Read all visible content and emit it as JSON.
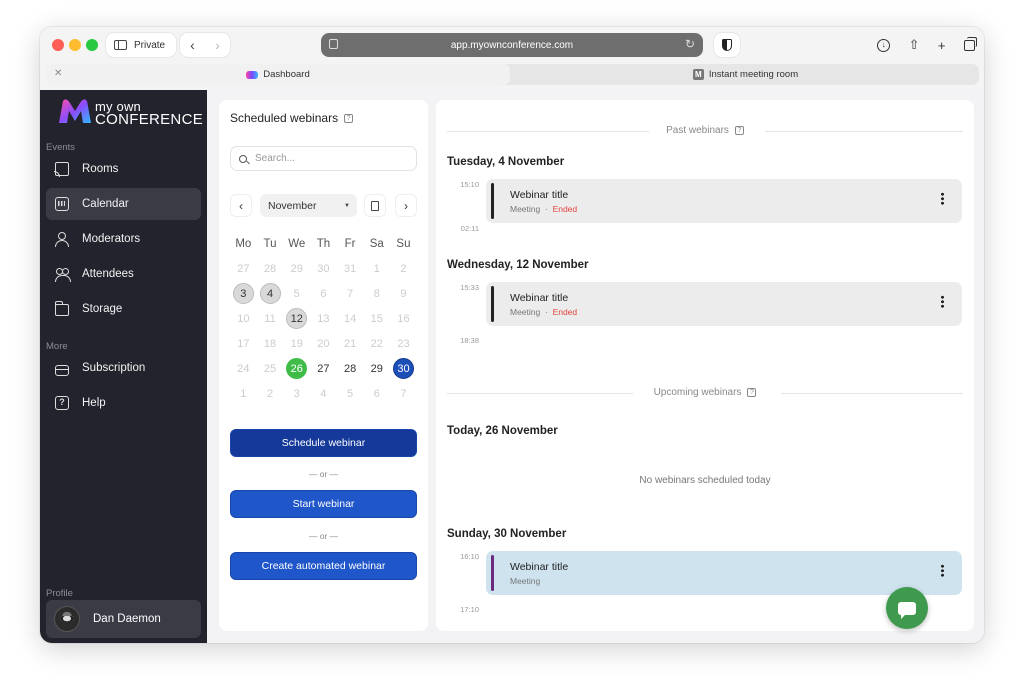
{
  "browser": {
    "private_label": "Private",
    "url": "app.myownconference.com",
    "tabs": [
      {
        "label": "Dashboard",
        "active": true
      },
      {
        "label": "Instant meeting room",
        "active": false
      }
    ]
  },
  "sidebar": {
    "logo_top": "my own",
    "logo_bottom": "CONFERENCE",
    "events_label": "Events",
    "items": [
      {
        "label": "Rooms",
        "icon": "cast-icon"
      },
      {
        "label": "Calendar",
        "icon": "calendar-icon",
        "active": true
      },
      {
        "label": "Moderators",
        "icon": "moderator-icon"
      },
      {
        "label": "Attendees",
        "icon": "attendees-icon"
      },
      {
        "label": "Storage",
        "icon": "folder-icon"
      }
    ],
    "more_label": "More",
    "more_items": [
      {
        "label": "Subscription",
        "icon": "card-icon"
      },
      {
        "label": "Help",
        "icon": "help-icon"
      }
    ],
    "profile_label": "Profile",
    "profile_name": "Dan Daemon"
  },
  "scheduler": {
    "title": "Scheduled webinars",
    "search_placeholder": "Search...",
    "month": "November",
    "weekdays": [
      "Mo",
      "Tu",
      "We",
      "Th",
      "Fr",
      "Sa",
      "Su"
    ],
    "weeks": [
      [
        "27",
        "28",
        "29",
        "30",
        "31",
        "1",
        "2"
      ],
      [
        "3",
        "4",
        "5",
        "6",
        "7",
        "8",
        "9"
      ],
      [
        "10",
        "11",
        "12",
        "13",
        "14",
        "15",
        "16"
      ],
      [
        "17",
        "18",
        "19",
        "20",
        "21",
        "22",
        "23"
      ],
      [
        "24",
        "25",
        "26",
        "27",
        "28",
        "29",
        "30"
      ],
      [
        "1",
        "2",
        "3",
        "4",
        "5",
        "6",
        "7"
      ]
    ],
    "schedule_button": "Schedule webinar",
    "or_label": "— or —",
    "start_button": "Start webinar",
    "automated_button": "Create automated webinar"
  },
  "timeline": {
    "past_label": "Past webinars",
    "upcoming_label": "Upcoming webinars",
    "days": [
      {
        "heading": "Tuesday, 4 November",
        "start": "15:10",
        "end": "02:11",
        "title": "Webinar title",
        "type": "Meeting",
        "status": "Ended"
      },
      {
        "heading": "Wednesday, 12 November",
        "start": "15:33",
        "end": "18:38",
        "title": "Webinar title",
        "type": "Meeting",
        "status": "Ended"
      },
      {
        "heading": "Today, 26 November",
        "empty": "No webinars scheduled today"
      },
      {
        "heading": "Sunday, 30 November",
        "start": "16:10",
        "end": "17:10",
        "title": "Webinar title",
        "type": "Meeting"
      }
    ],
    "meta_separator": "·"
  },
  "colors": {
    "sidebar_bg": "#22232c",
    "primary_blue": "#1f56c9",
    "today_green": "#3fbc48",
    "ended_red": "#e0463f",
    "upcoming_card": "#cfe3ef"
  }
}
